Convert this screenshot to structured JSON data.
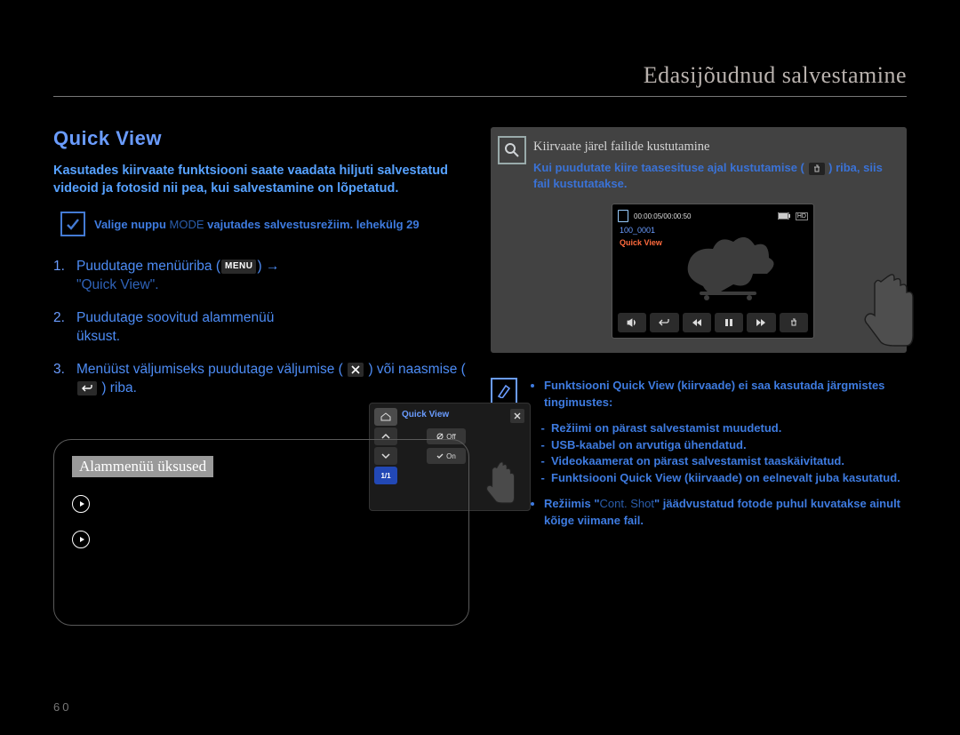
{
  "header": "Edasijõudnud salvestamine",
  "section_title": "Quick View",
  "intro": "Kasutades kiirvaate funktsiooni saate vaadata hiljuti salvestatud videoid ja fotosid nii pea, kui salvestamine on lõpetatud.",
  "prereq": {
    "before": "Valige nuppu ",
    "mode": "MODE",
    "after": " vajutades salvestusrežiim. lehekülg 29"
  },
  "steps": {
    "s1a": "Puudutage menüüriba",
    "s1b": "(",
    "s1c": ") →",
    "s1d": "\"Quick View\".",
    "s2": "Puudutage soovitud alammenüü üksust.",
    "s3a": "Menüüst väljumiseks puudutage väljumise (",
    "s3b": ") või naasmise (",
    "s3c": ") riba."
  },
  "steps_figure": {
    "title": "Quick View",
    "off": "Off",
    "on": "On",
    "half": "1/1"
  },
  "submenu": {
    "title": "Alammenüü üksused"
  },
  "delete_box": {
    "title": "Kiirvaate järel failide kustutamine",
    "desc_a": "Kui puudutate kiire taasesituse ajal kustutamise (",
    "desc_b": ") riba, siis fail kustutatakse."
  },
  "player": {
    "time": "00:00:05/00:00:50",
    "label": "100_0001",
    "qv": "Quick View"
  },
  "note": {
    "intro": "Funktsiooni Quick View (kiirvaade) ei saa kasutada järgmistes tingimustes:",
    "d1": "Režiimi on pärast salvestamist muudetud.",
    "d2": "USB-kaabel on arvutiga ühendatud.",
    "d3": "Videokaamerat on pärast salvestamist taaskäivitatud.",
    "d4": "Funktsiooni Quick View (kiirvaade) on eelnevalt juba kasutatud.",
    "b2a": "Režiimis \"",
    "b2b": "Cont. Shot",
    "b2c": "\" jäädvustatud fotode puhul kuvatakse ainult kõige viimane fail."
  },
  "page_number": "60"
}
